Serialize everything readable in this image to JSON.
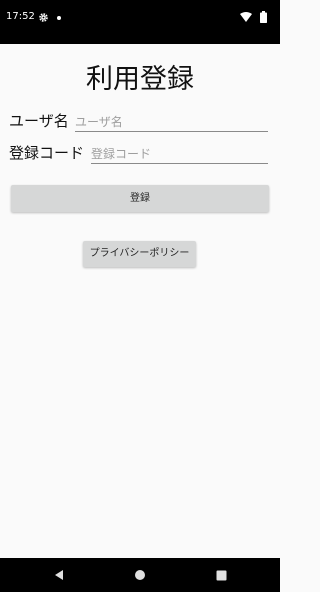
{
  "status_bar": {
    "time": "17:52",
    "icons": [
      "gear-icon",
      "notification-dot-icon",
      "wifi-icon",
      "battery-icon"
    ]
  },
  "page": {
    "title": "利用登録"
  },
  "form": {
    "username_label": "ユーザ名",
    "username_placeholder": "ユーザ名",
    "username_value": "",
    "code_label": "登録コード",
    "code_placeholder": "登録コード",
    "code_value": ""
  },
  "buttons": {
    "register_label": "登録",
    "privacy_label": "プライバシーポリシー"
  },
  "nav_bar": {
    "icons": [
      "back-icon",
      "home-icon",
      "recents-icon"
    ]
  },
  "colors": {
    "background": "#fafafa",
    "button": "#d6d7d7",
    "bars": "#000000"
  }
}
